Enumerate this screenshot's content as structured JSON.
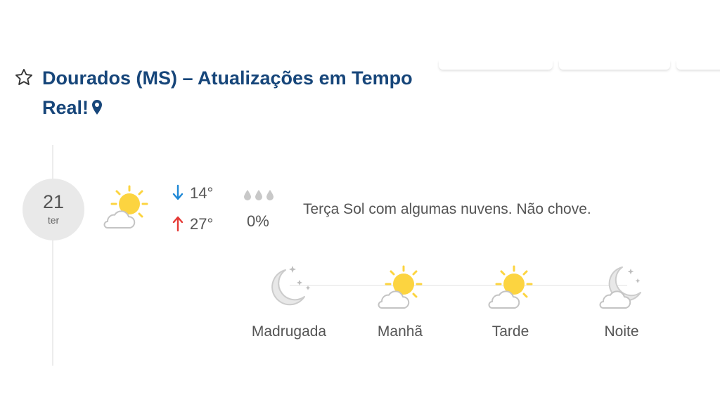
{
  "header": {
    "title": "Dourados (MS) – Atualizações em Tempo Real!"
  },
  "forecast": {
    "day_number": "21",
    "weekday": "ter",
    "temp_min": "14°",
    "temp_max": "27°",
    "rain_chance": "0%",
    "description": "Terça Sol com algumas nuvens. Não chove.",
    "day_icon": "sun-with-cloud-icon",
    "periods": [
      {
        "label": "Madrugada",
        "icon": "moon-stars-icon"
      },
      {
        "label": "Manhã",
        "icon": "sun-with-cloud-icon"
      },
      {
        "label": "Tarde",
        "icon": "sun-with-cloud-icon"
      },
      {
        "label": "Noite",
        "icon": "moon-stars-cloud-icon"
      }
    ]
  },
  "colors": {
    "title": "#17467a",
    "arrow_down": "#1e88d6",
    "arrow_up": "#e53935",
    "sun": "#fcd440",
    "text": "#555555"
  }
}
